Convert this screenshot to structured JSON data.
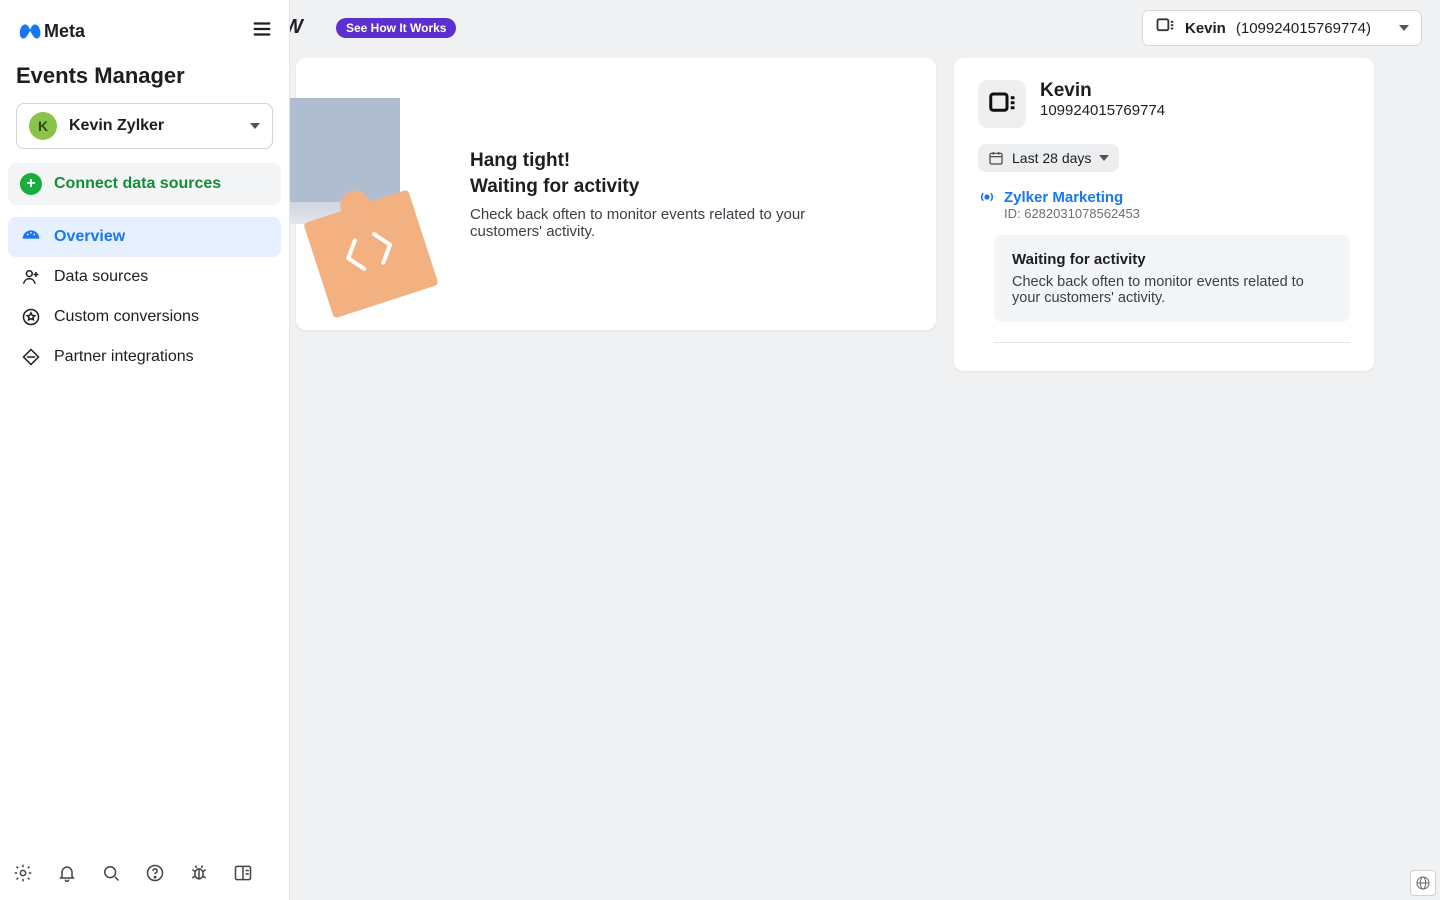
{
  "brand": {
    "word": "Meta",
    "slice": "W"
  },
  "topbar": {
    "see_how": "See How It Works",
    "pixel_selector": {
      "name": "Kevin",
      "id": "(109924015769774)"
    }
  },
  "sidebar": {
    "title": "Events Manager",
    "account": {
      "initial": "K",
      "name": "Kevin Zylker"
    },
    "connect_label": "Connect data sources",
    "items": [
      {
        "label": "Overview"
      },
      {
        "label": "Data sources"
      },
      {
        "label": "Custom conversions"
      },
      {
        "label": "Partner integrations"
      }
    ]
  },
  "hang": {
    "h1": "Hang tight!",
    "h2": "Waiting for activity",
    "body": "Check back often to monitor events related to your customers' activity."
  },
  "pixel_panel": {
    "name": "Kevin",
    "id": "109924015769774",
    "daterange": "Last 28 days",
    "ad_account": "Zylker Marketing",
    "ad_account_id": "ID: 6282031078562453",
    "wait_title": "Waiting for activity",
    "wait_body": "Check back often to monitor events related to your customers' activity."
  }
}
